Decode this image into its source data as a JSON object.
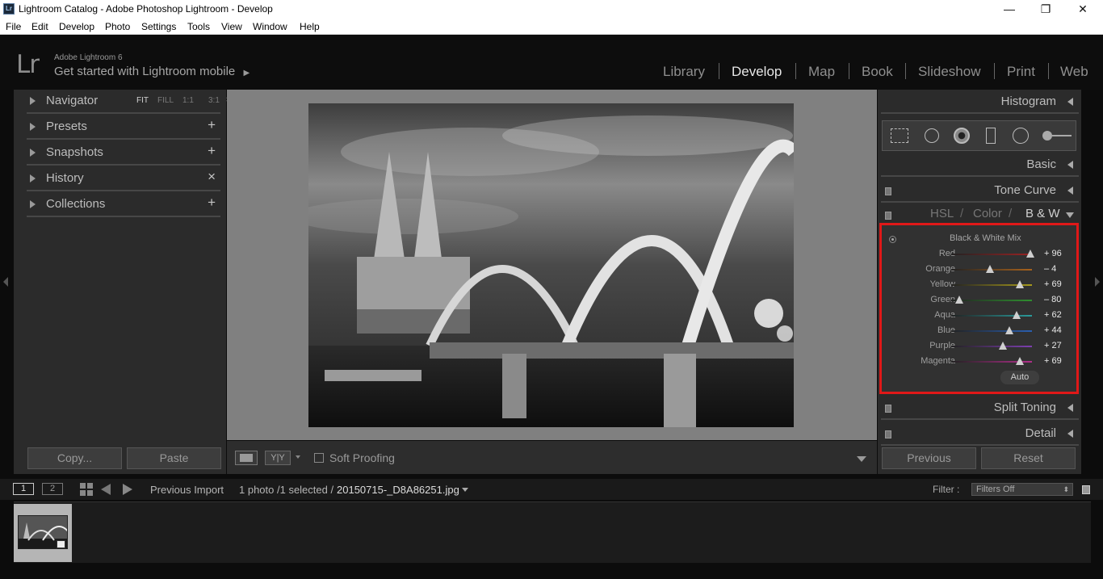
{
  "window": {
    "title": "Lightroom Catalog - Adobe Photoshop Lightroom - Develop",
    "app_icon": "Lr",
    "controls": {
      "minimize": "—",
      "restore": "❐",
      "close": "✕"
    }
  },
  "menu": [
    "File",
    "Edit",
    "Develop",
    "Photo",
    "Settings",
    "Tools",
    "View",
    "Window",
    "Help"
  ],
  "identity": {
    "logo": "Lr",
    "product": "Adobe Lightroom 6",
    "mobile_link": "Get started with Lightroom mobile",
    "mobile_arrow": "▶"
  },
  "modules": [
    {
      "label": "Library",
      "active": false
    },
    {
      "label": "Develop",
      "active": true
    },
    {
      "label": "Map",
      "active": false
    },
    {
      "label": "Book",
      "active": false
    },
    {
      "label": "Slideshow",
      "active": false
    },
    {
      "label": "Print",
      "active": false
    },
    {
      "label": "Web",
      "active": false
    }
  ],
  "left_panel": {
    "navigator": {
      "label": "Navigator",
      "options": [
        "FIT",
        "FILL",
        "1:1",
        "3:1"
      ],
      "active_option": "FIT",
      "stepper": "⬍"
    },
    "sections": [
      {
        "label": "Presets",
        "action": "+"
      },
      {
        "label": "Snapshots",
        "action": "+"
      },
      {
        "label": "History",
        "action": "×"
      },
      {
        "label": "Collections",
        "action": "+"
      }
    ],
    "copy_label": "Copy...",
    "paste_label": "Paste"
  },
  "toolbar": {
    "view_compare": "Y|Y",
    "soft_proofing_label": "Soft Proofing",
    "soft_proofing_checked": false
  },
  "right_panel": {
    "histogram": "Histogram",
    "tools": [
      "crop-overlay-icon",
      "spot-removal-icon",
      "red-eye-icon",
      "graduated-filter-icon",
      "radial-filter-icon",
      "adjustment-brush-icon"
    ],
    "basic": "Basic",
    "tone_curve": "Tone Curve",
    "hsl_tabs": [
      "HSL",
      "Color",
      "B & W"
    ],
    "hsl_separator": "/",
    "hsl_active": "B & W",
    "bw_mix_title": "Black & White Mix",
    "bw_mix": [
      {
        "label": "Red",
        "value": 96,
        "display": "+ 96",
        "track": "#9a2222"
      },
      {
        "label": "Orange",
        "value": -4,
        "display": "– 4",
        "track": "#a8621c"
      },
      {
        "label": "Yellow",
        "value": 69,
        "display": "+ 69",
        "track": "#a89a1c"
      },
      {
        "label": "Green",
        "value": -80,
        "display": "– 80",
        "track": "#2f8f2f"
      },
      {
        "label": "Aqua",
        "value": 62,
        "display": "+ 62",
        "track": "#2a9a9a"
      },
      {
        "label": "Blue",
        "value": 44,
        "display": "+ 44",
        "track": "#2a5fb0"
      },
      {
        "label": "Purple",
        "value": 27,
        "display": "+ 27",
        "track": "#7d3fb0"
      },
      {
        "label": "Magenta",
        "value": 69,
        "display": "+ 69",
        "track": "#b02f8a"
      }
    ],
    "auto_label": "Auto",
    "split_toning": "Split Toning",
    "detail": "Detail",
    "previous_label": "Previous",
    "reset_label": "Reset"
  },
  "filmbar": {
    "screen1": "1",
    "screen2": "2",
    "source": "Previous Import",
    "count": "1 photo /1 selected /",
    "filename": "20150715-_D8A86251.jpg",
    "filter_label": "Filter :",
    "filter_value": "Filters Off"
  },
  "colors": {
    "accent_highlight": "#e01818",
    "panel_bg": "#2b2b2b",
    "center_bg": "#808080"
  }
}
